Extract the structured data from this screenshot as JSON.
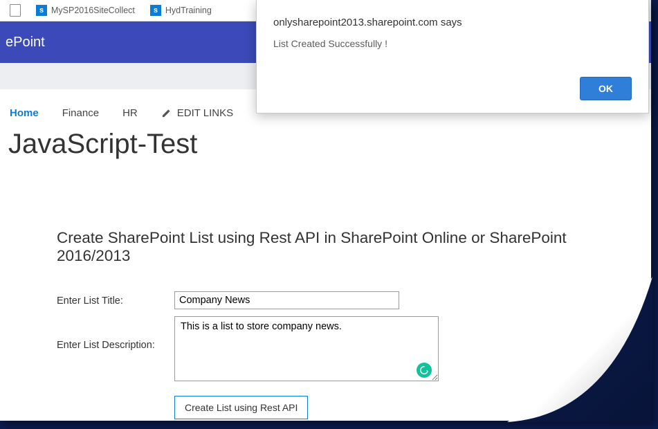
{
  "tabs": {
    "tab1_text": "MySP2016SiteCollect",
    "tab2_text": "HydTraining"
  },
  "ribbon": {
    "title": "ePoint"
  },
  "nav": {
    "items": [
      "Home",
      "Finance",
      "HR"
    ],
    "edit_links_label": "EDIT LINKS"
  },
  "page_title": "JavaScript-Test",
  "form": {
    "heading": "Create SharePoint List using Rest API in SharePoint Online or SharePoint 2016/2013",
    "title_label": "Enter List Title:",
    "title_value": "Company News",
    "desc_label": "Enter List Description:",
    "desc_value": "This is a list to store company news.",
    "button_label": "Create List using Rest API"
  },
  "alert": {
    "origin": "onlysharepoint2013.sharepoint.com says",
    "message": "List Created Successfully !",
    "ok_label": "OK"
  }
}
